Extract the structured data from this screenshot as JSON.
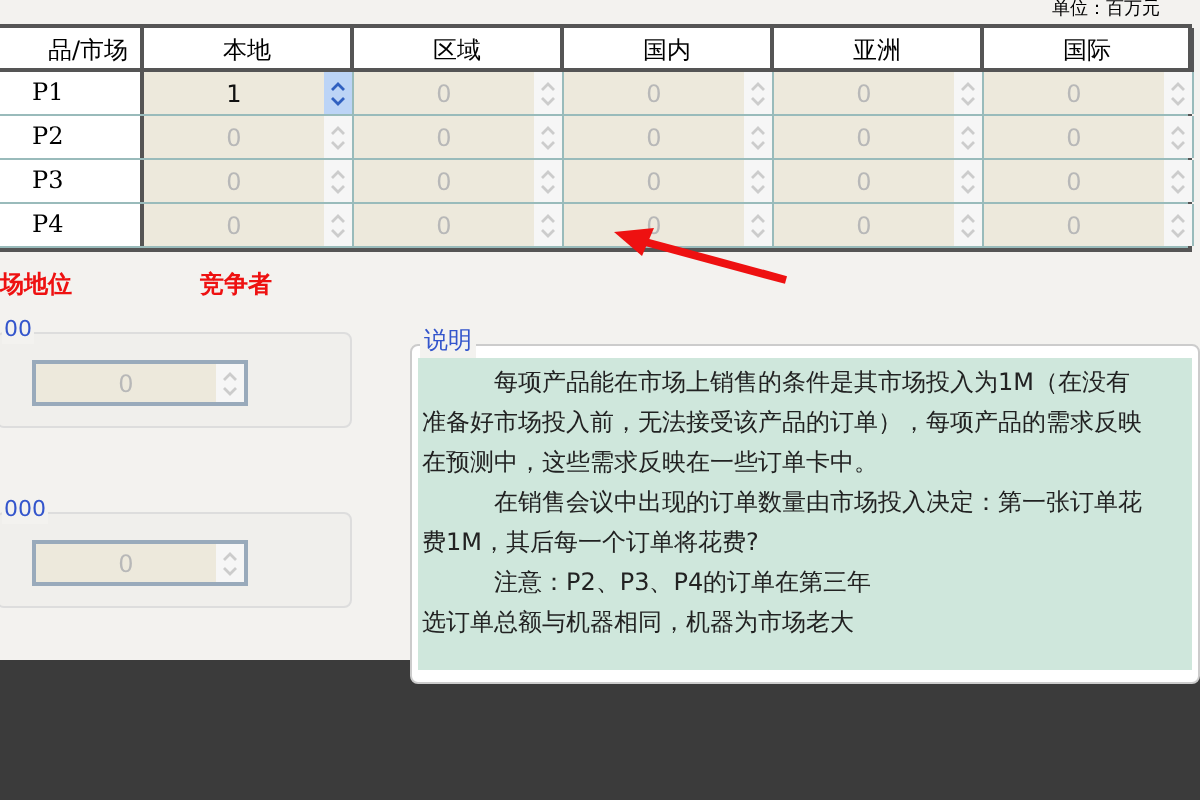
{
  "unit_label": "单位：百万元",
  "table": {
    "corner": "品/市场",
    "columns": [
      "本地",
      "区域",
      "国内",
      "亚洲",
      "国际"
    ],
    "rows": [
      {
        "product": "P1",
        "cells": [
          {
            "value": "1",
            "disabled": false
          },
          {
            "value": "0",
            "disabled": true
          },
          {
            "value": "0",
            "disabled": true
          },
          {
            "value": "0",
            "disabled": true
          },
          {
            "value": "0",
            "disabled": true
          }
        ]
      },
      {
        "product": "P2",
        "cells": [
          {
            "value": "0",
            "disabled": true
          },
          {
            "value": "0",
            "disabled": true
          },
          {
            "value": "0",
            "disabled": true
          },
          {
            "value": "0",
            "disabled": true
          },
          {
            "value": "0",
            "disabled": true
          }
        ]
      },
      {
        "product": "P3",
        "cells": [
          {
            "value": "0",
            "disabled": true
          },
          {
            "value": "0",
            "disabled": true
          },
          {
            "value": "0",
            "disabled": true
          },
          {
            "value": "0",
            "disabled": true
          },
          {
            "value": "0",
            "disabled": true
          }
        ]
      },
      {
        "product": "P4",
        "cells": [
          {
            "value": "0",
            "disabled": true
          },
          {
            "value": "0",
            "disabled": true
          },
          {
            "value": "0",
            "disabled": true
          },
          {
            "value": "0",
            "disabled": true
          },
          {
            "value": "0",
            "disabled": true
          }
        ]
      }
    ]
  },
  "red_labels": [
    "场地位",
    "竞争者"
  ],
  "groups": [
    {
      "legend": "00",
      "value": "0",
      "disabled": true
    },
    {
      "legend": "000",
      "value": "0",
      "disabled": true
    }
  ],
  "notes": {
    "title": "说明",
    "paragraphs": [
      "每项产品能在市场上销售的条件是其市场投入为1M（在没有准备好市场投入前，无法接受该产品的订单），每项产品的需求反映在预测中，这些需求反映在一些订单卡中。",
      "在销售会议中出现的订单数量由市场投入决定：第一张订单花费1M，其后每一个订单将花费?",
      "注意：P2、P3、P4的订单在第三年",
      "选订单总额与机器相同，机器为市场老大"
    ]
  }
}
